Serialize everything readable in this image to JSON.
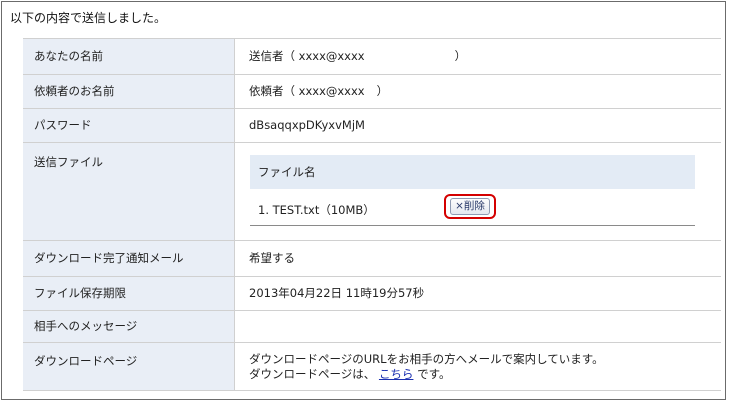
{
  "heading": "以下の内容で送信しました。",
  "rows": {
    "your_name": {
      "label": "あなたの名前",
      "prefix": "送信者（",
      "email": "xxxx@xxxx",
      "suffix": "）"
    },
    "requester_name": {
      "label": "依頼者のお名前",
      "prefix": "依頼者（",
      "email": "xxxx@xxxx",
      "suffix": "）"
    },
    "password": {
      "label": "パスワード",
      "value": "dBsaqqxpDKyxvMjM"
    },
    "send_files": {
      "label": "送信ファイル",
      "column_header": "ファイル名",
      "files": [
        {
          "name": "1. TEST.txt（10MB）",
          "delete_label": "×削除"
        }
      ]
    },
    "notify_mail": {
      "label": "ダウンロード完了通知メール",
      "value": "希望する"
    },
    "retention": {
      "label": "ファイル保存期限",
      "value": "2013年04月22日 11時19分57秒"
    },
    "message": {
      "label": "相手へのメッセージ",
      "value": ""
    },
    "download_page": {
      "label": "ダウンロードページ",
      "line1": "ダウンロードページのURLをお相手の方へメールで案内しています。",
      "line2_prefix": "ダウンロードページは、",
      "link": "こちら",
      "line2_suffix": "です。"
    }
  },
  "colors": {
    "label_bg": "#e9eef6",
    "highlight": "#d40000",
    "link": "#1a2fb0"
  }
}
